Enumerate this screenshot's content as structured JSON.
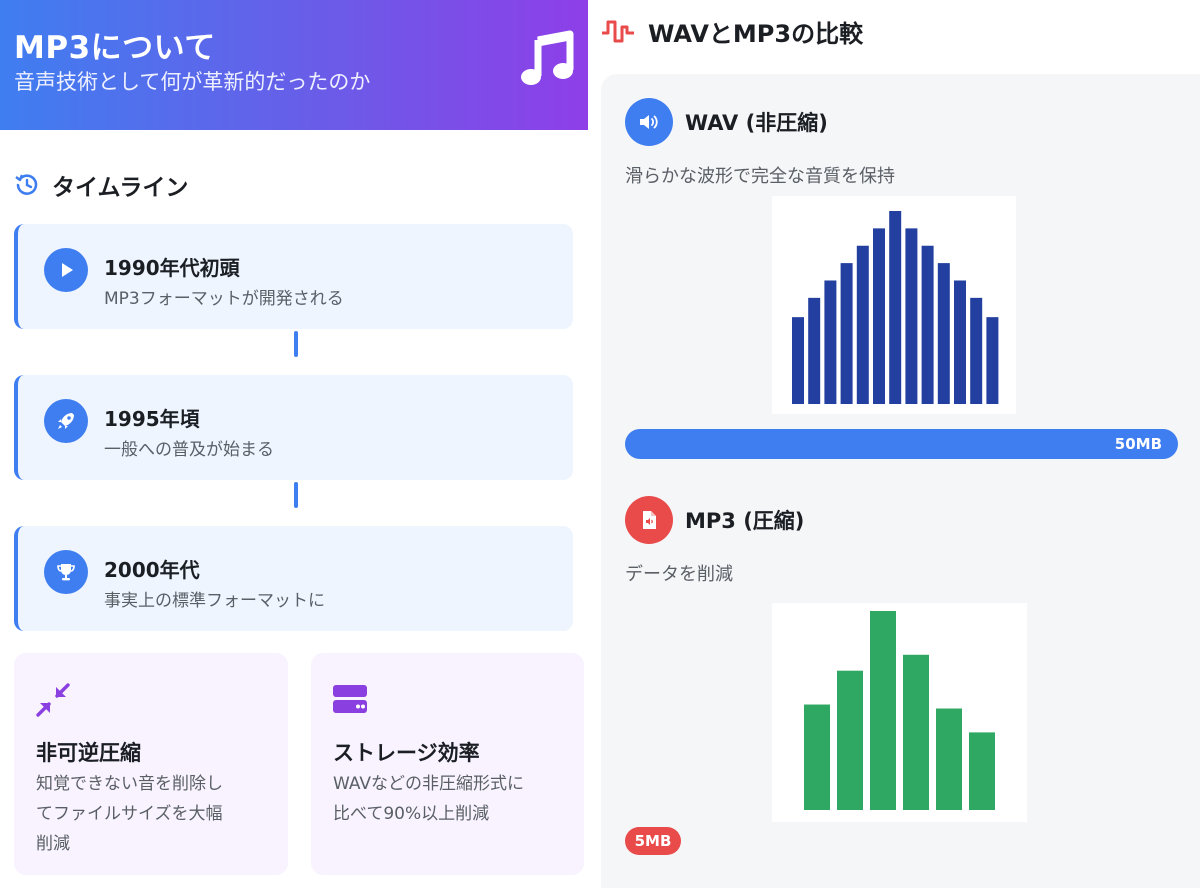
{
  "hero": {
    "title": "MP3について",
    "subtitle": "音声技術として何が革新的だったのか",
    "icon": "music-note-icon"
  },
  "timeline": {
    "heading": "タイムライン",
    "icon": "history-icon",
    "items": [
      {
        "title": "1990年代初頭",
        "desc": "MP3フォーマットが開発される",
        "icon": "play-icon"
      },
      {
        "title": "1995年頃",
        "desc": "一般への普及が始まる",
        "icon": "rocket-icon"
      },
      {
        "title": "2000年代",
        "desc": "事実上の標準フォーマットに",
        "icon": "trophy-icon"
      }
    ]
  },
  "features": [
    {
      "title": "非可逆圧縮",
      "desc_lines": [
        "知覚できない音を削除し",
        "てファイルサイズを大幅",
        "削減"
      ],
      "icon": "compress-icon",
      "color": "#8a3fe0"
    },
    {
      "title": "ストレージ効率",
      "desc_lines": [
        "WAVなどの非圧縮形式に",
        "比べて90%以上削減"
      ],
      "icon": "storage-icon",
      "color": "#8a3fe0"
    }
  ],
  "compare": {
    "heading": "WAVとMP3の比較",
    "icon": "waveform-icon",
    "wav": {
      "label": "WAV (非圧縮)",
      "desc": "滑らかな波形で完全な音質を保持",
      "icon": "speaker-icon",
      "color": "#3f7ef0",
      "bar_color": "#2340a0",
      "bars": [
        0.45,
        0.55,
        0.64,
        0.73,
        0.82,
        0.91,
        1.0,
        0.91,
        0.82,
        0.73,
        0.64,
        0.55,
        0.45
      ],
      "size_label": "50MB",
      "size_fraction": 1.0
    },
    "mp3": {
      "label": "MP3 (圧縮)",
      "desc": "データを削減",
      "icon": "audio-file-icon",
      "color": "#e94a4a",
      "bar_color": "#2ea862",
      "bars": [
        0.53,
        0.7,
        1.0,
        0.78,
        0.51,
        0.39
      ],
      "size_label": "5MB",
      "size_fraction": 0.1
    }
  }
}
